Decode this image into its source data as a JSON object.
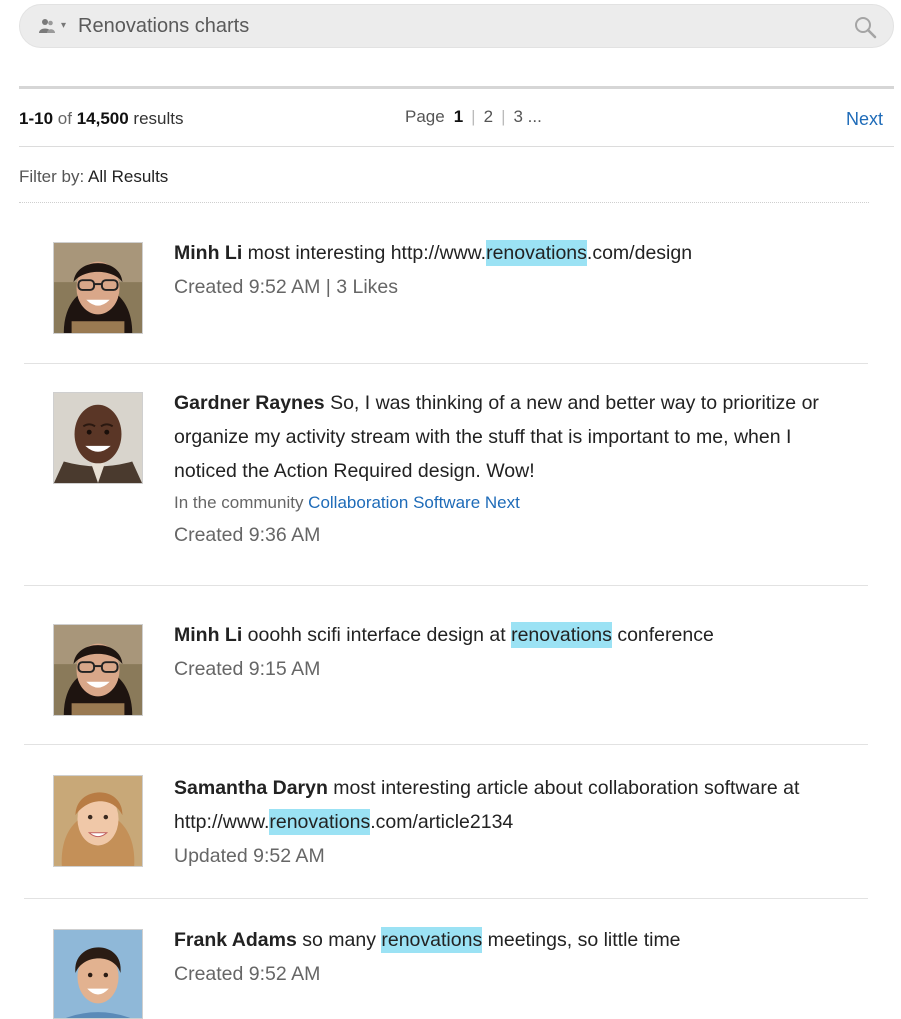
{
  "search": {
    "value": "Renovations charts",
    "scope_icon": "people-icon",
    "scope_caret": "▾",
    "submit_icon": "search-icon"
  },
  "results": {
    "range": "1-10",
    "of_word": "of",
    "total": "14,500",
    "results_word": "results"
  },
  "pager": {
    "page_label": "Page",
    "current": "1",
    "page2": "2",
    "page3": "3 ...",
    "next_label": "Next"
  },
  "filter": {
    "label": "Filter by:",
    "value": "All Results"
  },
  "highlight_color": "#9be2f4",
  "link_color": "#1e6bb8",
  "items": [
    {
      "author": "Minh Li",
      "pre": " most interesting http://www.",
      "highlight": "renovations",
      "post": ".com/design",
      "meta": "Created 9:52 AM  |  3 Likes"
    },
    {
      "author": "Gardner Raynes",
      "text": " So, I was thinking of a new and better way to prioritize or organize my activity stream with the stuff that is important to me, when I noticed the Action Required design. Wow!",
      "community_label": "In the community ",
      "community_link": "Collaboration Software Next",
      "meta": "Created 9:36 AM"
    },
    {
      "author": "Minh Li",
      "pre": " ooohh scifi interface design at ",
      "highlight": "renovations",
      "post": " conference",
      "meta": "Created 9:15 AM"
    },
    {
      "author": "Samantha Daryn",
      "pre": " most interesting article about collaboration software at http://www.",
      "highlight": "renovations",
      "post": ".com/article2134",
      "meta": "Updated 9:52 AM"
    },
    {
      "author": "Frank Adams",
      "pre": " so many ",
      "highlight": "renovations",
      "post": " meetings, so little time",
      "meta": "Created 9:52 AM"
    }
  ]
}
